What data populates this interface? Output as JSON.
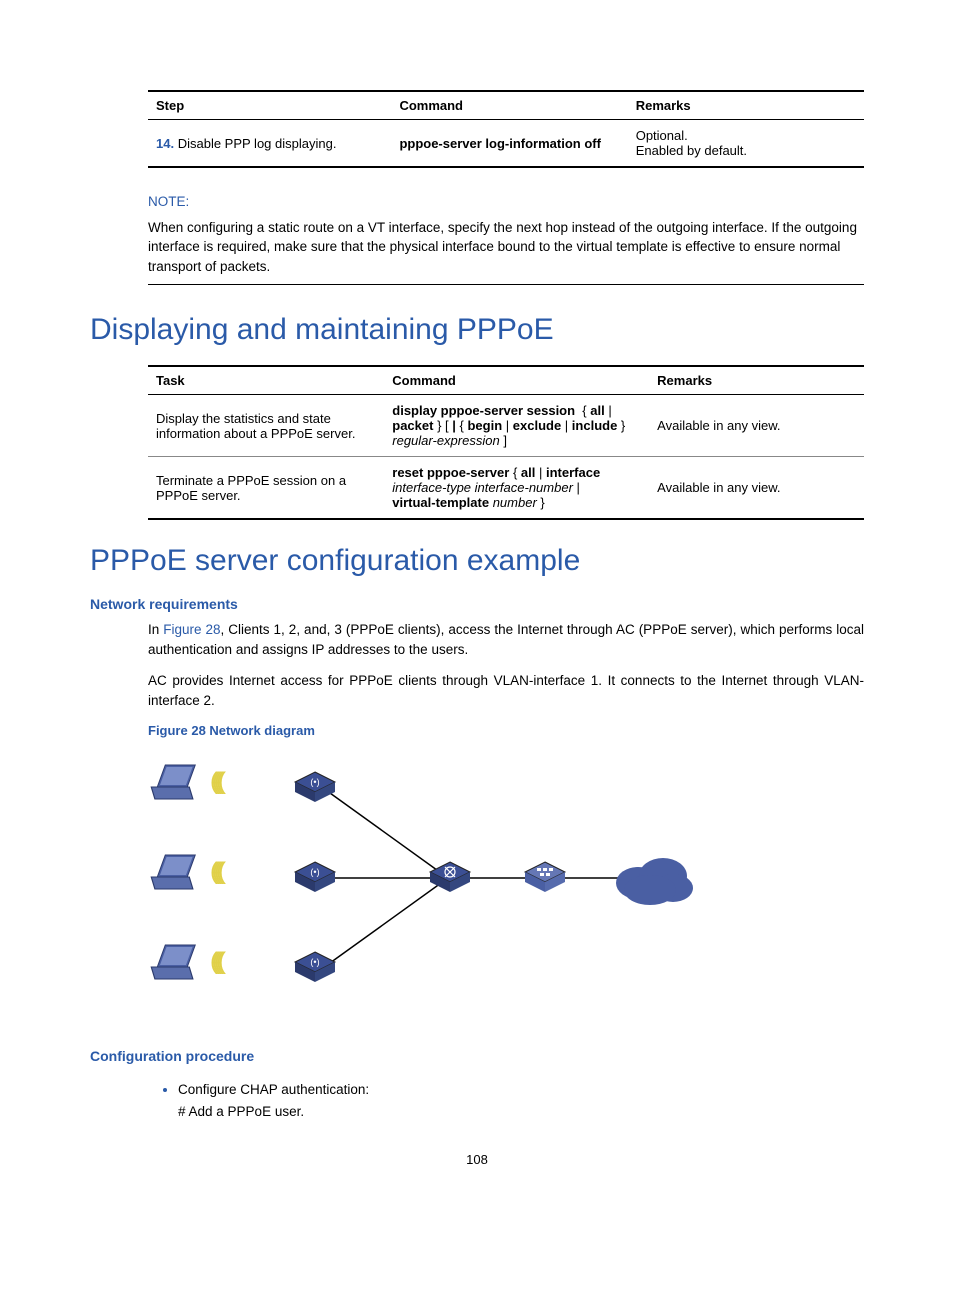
{
  "stepTable": {
    "headers": [
      "Step",
      "Command",
      "Remarks"
    ],
    "row": {
      "num": "14.",
      "desc": "Disable PPP log displaying.",
      "command": "pppoe-server log-information off",
      "remarks1": "Optional.",
      "remarks2": "Enabled by default."
    }
  },
  "note": {
    "label": "NOTE:",
    "text": "When configuring a static route on a VT interface, specify the next hop instead of the outgoing interface. If the outgoing interface is required, make sure that the physical interface bound to the virtual template is effective to ensure normal transport of packets."
  },
  "heading1": "Displaying and maintaining PPPoE",
  "taskTable": {
    "headers": [
      "Task",
      "Command",
      "Remarks"
    ],
    "rows": [
      {
        "task": "Display the statistics and state information about a PPPoE server.",
        "cmd_html": "<span class='cmd-bold'>display pppoe-server session</span> { <span class='cmd-bold'>all</span> | <span class='cmd-bold'>packet</span> } [ <span class='cmd-bold'>|</span> { <span class='cmd-bold'>begin</span> | <span class='cmd-bold'>exclude</span> | <span class='cmd-bold'>include</span> } <span class='cmd-ital'>regular-expression</span> ]",
        "cmd_line1": "display pppoe-server session",
        "cmd_line1b": "all",
        "cmd_line2a": "packet",
        "cmd_line2b": "|",
        "cmd_line2c": "begin",
        "cmd_line2d": "exclude",
        "cmd_line2e": "include",
        "remarks": "Available in any view."
      },
      {
        "task": "Terminate a PPPoE session on a PPPoE server.",
        "cmd_l1a": "reset pppoe-server",
        "cmd_l1b": " { ",
        "cmd_l1c": "all",
        "cmd_l1d": " | ",
        "cmd_l1e": "interface",
        "cmd_l2a": "interface-type interface-number",
        "cmd_l2b": " | ",
        "cmd_l3a": "virtual-template",
        "cmd_l3b": " number",
        "cmd_l3c": " }",
        "remarks": "Available in any view."
      }
    ]
  },
  "heading2": "PPPoE server configuration example",
  "netreq": {
    "label": "Network requirements",
    "p1a": "In ",
    "p1link": "Figure 28",
    "p1b": ", Clients 1, 2, and, 3 (PPPoE clients), access the Internet through AC (PPPoE server), which performs local authentication and assigns IP addresses to the users.",
    "p2": "AC provides Internet access for PPPoE clients through VLAN-interface 1. It connects to the Internet through VLAN-interface 2."
  },
  "figure": {
    "caption": "Figure 28 Network diagram"
  },
  "confproc": {
    "label": "Configuration procedure",
    "li1": "Configure CHAP authentication:",
    "li1sub": "# Add a PPPoE user."
  },
  "pageNumber": "108"
}
